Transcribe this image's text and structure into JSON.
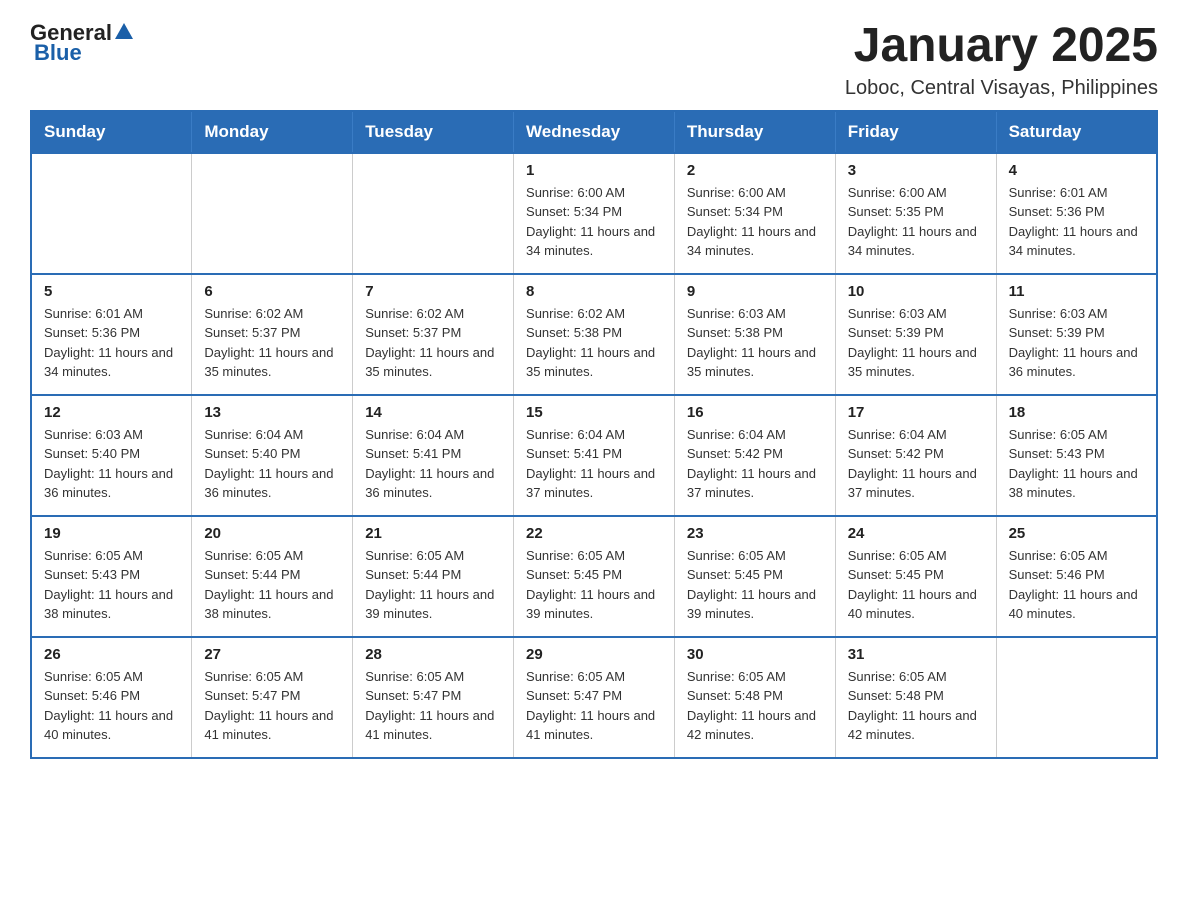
{
  "logo": {
    "general": "General",
    "blue": "Blue"
  },
  "header": {
    "month": "January 2025",
    "location": "Loboc, Central Visayas, Philippines"
  },
  "weekdays": [
    "Sunday",
    "Monday",
    "Tuesday",
    "Wednesday",
    "Thursday",
    "Friday",
    "Saturday"
  ],
  "weeks": [
    [
      {
        "day": "",
        "info": ""
      },
      {
        "day": "",
        "info": ""
      },
      {
        "day": "",
        "info": ""
      },
      {
        "day": "1",
        "info": "Sunrise: 6:00 AM\nSunset: 5:34 PM\nDaylight: 11 hours and 34 minutes."
      },
      {
        "day": "2",
        "info": "Sunrise: 6:00 AM\nSunset: 5:34 PM\nDaylight: 11 hours and 34 minutes."
      },
      {
        "day": "3",
        "info": "Sunrise: 6:00 AM\nSunset: 5:35 PM\nDaylight: 11 hours and 34 minutes."
      },
      {
        "day": "4",
        "info": "Sunrise: 6:01 AM\nSunset: 5:36 PM\nDaylight: 11 hours and 34 minutes."
      }
    ],
    [
      {
        "day": "5",
        "info": "Sunrise: 6:01 AM\nSunset: 5:36 PM\nDaylight: 11 hours and 34 minutes."
      },
      {
        "day": "6",
        "info": "Sunrise: 6:02 AM\nSunset: 5:37 PM\nDaylight: 11 hours and 35 minutes."
      },
      {
        "day": "7",
        "info": "Sunrise: 6:02 AM\nSunset: 5:37 PM\nDaylight: 11 hours and 35 minutes."
      },
      {
        "day": "8",
        "info": "Sunrise: 6:02 AM\nSunset: 5:38 PM\nDaylight: 11 hours and 35 minutes."
      },
      {
        "day": "9",
        "info": "Sunrise: 6:03 AM\nSunset: 5:38 PM\nDaylight: 11 hours and 35 minutes."
      },
      {
        "day": "10",
        "info": "Sunrise: 6:03 AM\nSunset: 5:39 PM\nDaylight: 11 hours and 35 minutes."
      },
      {
        "day": "11",
        "info": "Sunrise: 6:03 AM\nSunset: 5:39 PM\nDaylight: 11 hours and 36 minutes."
      }
    ],
    [
      {
        "day": "12",
        "info": "Sunrise: 6:03 AM\nSunset: 5:40 PM\nDaylight: 11 hours and 36 minutes."
      },
      {
        "day": "13",
        "info": "Sunrise: 6:04 AM\nSunset: 5:40 PM\nDaylight: 11 hours and 36 minutes."
      },
      {
        "day": "14",
        "info": "Sunrise: 6:04 AM\nSunset: 5:41 PM\nDaylight: 11 hours and 36 minutes."
      },
      {
        "day": "15",
        "info": "Sunrise: 6:04 AM\nSunset: 5:41 PM\nDaylight: 11 hours and 37 minutes."
      },
      {
        "day": "16",
        "info": "Sunrise: 6:04 AM\nSunset: 5:42 PM\nDaylight: 11 hours and 37 minutes."
      },
      {
        "day": "17",
        "info": "Sunrise: 6:04 AM\nSunset: 5:42 PM\nDaylight: 11 hours and 37 minutes."
      },
      {
        "day": "18",
        "info": "Sunrise: 6:05 AM\nSunset: 5:43 PM\nDaylight: 11 hours and 38 minutes."
      }
    ],
    [
      {
        "day": "19",
        "info": "Sunrise: 6:05 AM\nSunset: 5:43 PM\nDaylight: 11 hours and 38 minutes."
      },
      {
        "day": "20",
        "info": "Sunrise: 6:05 AM\nSunset: 5:44 PM\nDaylight: 11 hours and 38 minutes."
      },
      {
        "day": "21",
        "info": "Sunrise: 6:05 AM\nSunset: 5:44 PM\nDaylight: 11 hours and 39 minutes."
      },
      {
        "day": "22",
        "info": "Sunrise: 6:05 AM\nSunset: 5:45 PM\nDaylight: 11 hours and 39 minutes."
      },
      {
        "day": "23",
        "info": "Sunrise: 6:05 AM\nSunset: 5:45 PM\nDaylight: 11 hours and 39 minutes."
      },
      {
        "day": "24",
        "info": "Sunrise: 6:05 AM\nSunset: 5:45 PM\nDaylight: 11 hours and 40 minutes."
      },
      {
        "day": "25",
        "info": "Sunrise: 6:05 AM\nSunset: 5:46 PM\nDaylight: 11 hours and 40 minutes."
      }
    ],
    [
      {
        "day": "26",
        "info": "Sunrise: 6:05 AM\nSunset: 5:46 PM\nDaylight: 11 hours and 40 minutes."
      },
      {
        "day": "27",
        "info": "Sunrise: 6:05 AM\nSunset: 5:47 PM\nDaylight: 11 hours and 41 minutes."
      },
      {
        "day": "28",
        "info": "Sunrise: 6:05 AM\nSunset: 5:47 PM\nDaylight: 11 hours and 41 minutes."
      },
      {
        "day": "29",
        "info": "Sunrise: 6:05 AM\nSunset: 5:47 PM\nDaylight: 11 hours and 41 minutes."
      },
      {
        "day": "30",
        "info": "Sunrise: 6:05 AM\nSunset: 5:48 PM\nDaylight: 11 hours and 42 minutes."
      },
      {
        "day": "31",
        "info": "Sunrise: 6:05 AM\nSunset: 5:48 PM\nDaylight: 11 hours and 42 minutes."
      },
      {
        "day": "",
        "info": ""
      }
    ]
  ]
}
